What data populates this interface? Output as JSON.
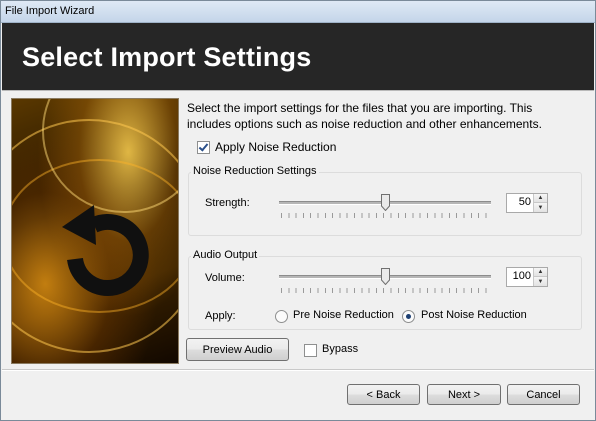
{
  "window": {
    "title": "File Import Wizard"
  },
  "banner": {
    "heading": "Select Import Settings"
  },
  "intro_text": "Select the import settings for the files that you are importing. This includes options such as noise reduction and other enhancements.",
  "apply_noise_reduction": {
    "label": "Apply Noise Reduction",
    "checked": true
  },
  "noise_group": {
    "title": "Noise Reduction Settings",
    "strength_label": "Strength:",
    "strength_value": "50",
    "strength_fraction": 0.5
  },
  "audio_group": {
    "title": "Audio Output",
    "volume_label": "Volume:",
    "volume_value": "100",
    "volume_fraction": 0.5,
    "apply_label": "Apply:",
    "options": [
      "Pre Noise Reduction",
      "Post Noise Reduction"
    ],
    "selected": "Post Noise Reduction"
  },
  "preview_button": "Preview Audio",
  "bypass": {
    "label": "Bypass",
    "checked": false
  },
  "nav": {
    "back": "< Back",
    "next": "Next >",
    "cancel": "Cancel"
  },
  "icons": {
    "side_image": "refresh-arrow-icon",
    "spin_up": "spin-up-icon",
    "spin_down": "spin-down-icon"
  },
  "colors": {
    "banner_bg": "#262626",
    "banner_text": "#ffffff",
    "accent_gold": "#e0a020"
  }
}
